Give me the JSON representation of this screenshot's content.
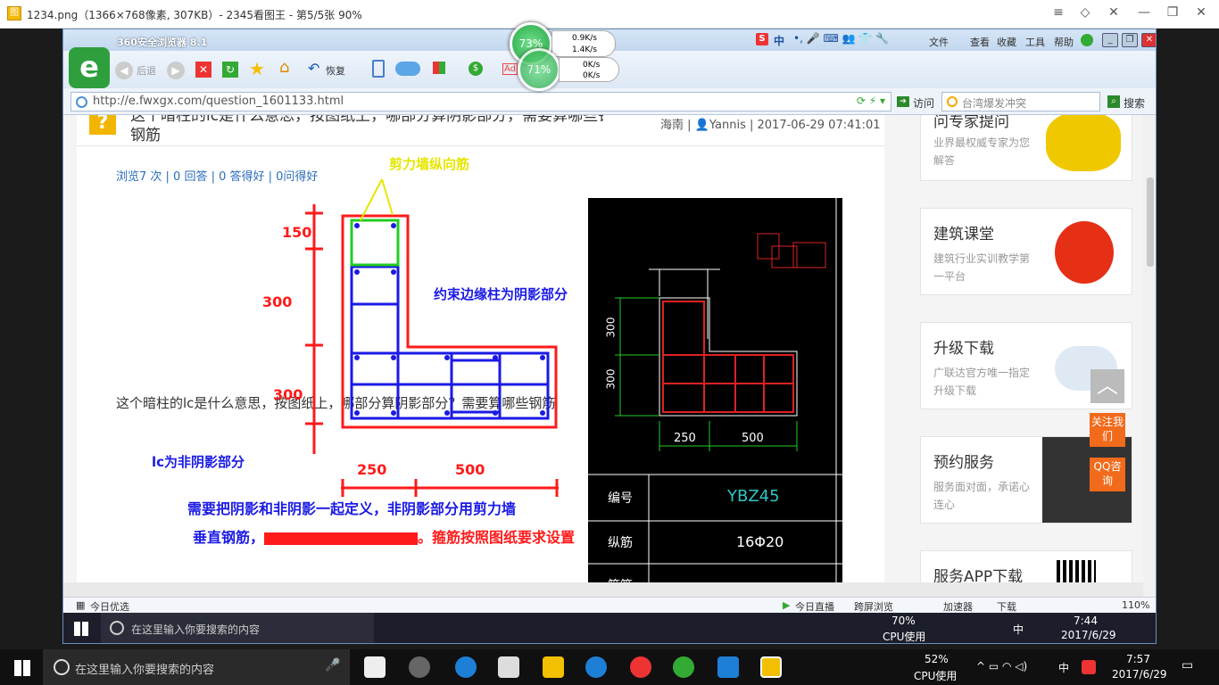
{
  "viewer": {
    "title": "1234.png（1366×768像素, 307KB）- 2345看图王 - 第5/5张 90%",
    "icon": "image-viewer-icon"
  },
  "browser": {
    "title": "360安全浏览器 8.1",
    "nav": {
      "back": "后退",
      "restore": "恢复"
    },
    "menu": [
      "文件",
      "查看",
      "收藏",
      "工具",
      "帮助"
    ],
    "url": "http://e.fwxgx.com/question_1601133.html",
    "visit": "访问",
    "search_placeholder": "台湾爆发冲突",
    "search_btn": "搜索",
    "ime": "中",
    "speed": {
      "up": "0.9K/s",
      "down": "1.4K/s",
      "up2": "0K/s",
      "down2": "0K/s"
    },
    "float_pct": "73%",
    "float_pct2": "71%"
  },
  "article": {
    "title_line1": "这个暗柱的lc是什么意思，按图纸上，哪部分算阴影部分，需要算哪些钢",
    "title_line2": "钢筋",
    "meta_loc": "海南",
    "meta_user": "Yannis",
    "meta_time": "2017-06-29 07:41:01",
    "stats": "浏览7 次 | 0 回答 | 0 答得好 | 0问得好",
    "question": "这个暗柱的lc是什么意思，按图纸上，哪部分算阴影部分？需要算哪些钢筋"
  },
  "diagram": {
    "label_wall_rebar": "剪力墙纵向筋",
    "label_shaded": "约束边缘柱为阴影部分",
    "dim_150": "150",
    "dim_300a": "300",
    "dim_300b": "300",
    "dim_250": "250",
    "dim_500": "500",
    "label_lc": "lc为非阴影部分",
    "note1": "需要把阴影和非阴影一起定义，非阴影部分用剪力墙",
    "note2_prefix": "垂直钢筋，",
    "note2_suffix": "。箍筋按照图纸要求设置"
  },
  "cad": {
    "dim_300a": "300",
    "dim_300b": "300",
    "dim_250": "250",
    "dim_500": "500",
    "row1_label": "编号",
    "row1_value": "YBZ45",
    "row2_label": "纵筋",
    "row2_value": "16Φ20",
    "row3_label": "箍筋"
  },
  "sidebar": {
    "card0_title": "问专家提问",
    "card0_desc": "业界最权威专家为您解答",
    "card1_title": "建筑课堂",
    "card1_desc": "建筑行业实训教学第一平台",
    "card2_title": "升级下载",
    "card2_desc": "广联达官方唯一指定升级下载",
    "card3_title": "预约服务",
    "card3_desc": "服务面对面，承诺心连心",
    "card4_title": "服务APP下载",
    "follow_btn": "关注我们",
    "qq_btn": "QQ咨询"
  },
  "statusbar": {
    "left": "今日优选",
    "live": "今日直播",
    "cross": "跨屏浏览",
    "accel": "加速器",
    "download": "下载",
    "zoom": "110%"
  },
  "inner_taskbar": {
    "search": "在这里输入你要搜索的内容",
    "cpu": "70%",
    "cpu_label": "CPU使用",
    "ime": "中",
    "time": "7:44",
    "date": "2017/6/29"
  },
  "taskbar": {
    "search": "在这里输入你要搜索的内容",
    "cpu": "52%",
    "cpu_label": "CPU使用",
    "ime": "中",
    "time": "7:57",
    "date": "2017/6/29"
  }
}
